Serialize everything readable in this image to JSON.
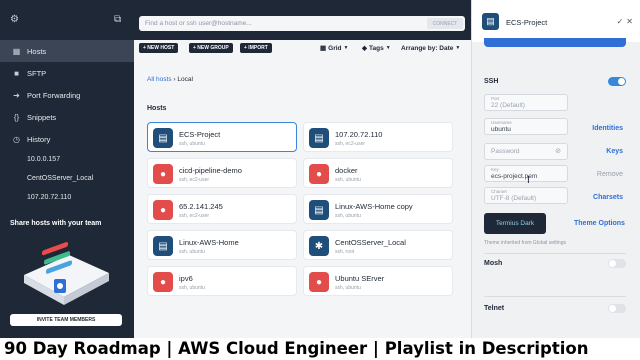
{
  "sidebar": {
    "nav": [
      {
        "label": "Hosts",
        "icon": "hosts-grid-icon",
        "active": true
      },
      {
        "label": "SFTP",
        "icon": "folder-icon",
        "active": false
      },
      {
        "label": "Port Forwarding",
        "icon": "arrow-right-icon",
        "active": false
      },
      {
        "label": "Snippets",
        "icon": "code-braces-icon",
        "active": false
      },
      {
        "label": "History",
        "icon": "clock-icon",
        "active": false
      }
    ],
    "history": [
      "10.0.0.157",
      "CentOSServer_Local",
      "107.20.72.110"
    ],
    "promo_title": "Share hosts with your team",
    "invite_label": "INVITE TEAM MEMBERS"
  },
  "main": {
    "search_placeholder": "Find a host or ssh user@hostname...",
    "connect_label": "CONNECT",
    "toolbar": {
      "new_host": "+ NEW HOST",
      "new_group": "+ NEW GROUP",
      "import": "+ IMPORT",
      "grid": "Grid",
      "tags": "Tags",
      "arrange": "Arrange by: Date"
    },
    "breadcrumb": {
      "root": "All hosts",
      "current": "Local"
    },
    "section_title": "Hosts",
    "hosts": [
      {
        "name": "ECS-Project",
        "sub": "ssh, ubuntu",
        "os": "server",
        "selected": true
      },
      {
        "name": "107.20.72.110",
        "sub": "ssh, ec2-user",
        "os": "server",
        "selected": false
      },
      {
        "name": "cicd-pipeline-demo",
        "sub": "ssh, ec2-user",
        "os": "linux",
        "selected": false
      },
      {
        "name": "docker",
        "sub": "ssh, ubuntu",
        "os": "linux",
        "selected": false
      },
      {
        "name": "65.2.141.245",
        "sub": "ssh, ec2-user",
        "os": "linux",
        "selected": false
      },
      {
        "name": "Linux-AWS-Home copy",
        "sub": "ssh, ubuntu",
        "os": "server",
        "selected": false
      },
      {
        "name": "Linux-AWS-Home",
        "sub": "ssh, ubuntu",
        "os": "server",
        "selected": false
      },
      {
        "name": "CentOSServer_Local",
        "sub": "ssh, root",
        "os": "centos",
        "selected": false
      },
      {
        "name": "ipv6",
        "sub": "ssh, ubuntu",
        "os": "linux",
        "selected": false
      },
      {
        "name": "Ubuntu SErver",
        "sub": "ssh, ubuntu",
        "os": "linux",
        "selected": false
      }
    ]
  },
  "panel": {
    "title": "ECS-Project",
    "ssh_label": "SSH",
    "ssh_enabled": true,
    "port": {
      "label": "Port",
      "placeholder": "22 (Default)"
    },
    "username": {
      "label": "Username",
      "value": "ubuntu"
    },
    "identities_link": "Identities",
    "password_placeholder": "Password",
    "keys_link": "Keys",
    "key": {
      "label": "Key",
      "value": "ecs-project.pem"
    },
    "remove_label": "Remove",
    "charset": {
      "label": "Charset",
      "placeholder": "UTF-8 (Default)"
    },
    "charsets_link": "Charsets",
    "theme_button": "Termius Dark",
    "theme_options": "Theme Options",
    "theme_note": "Theme inherited from Global settings",
    "mosh_label": "Mosh",
    "mosh_enabled": false,
    "telnet_label": "Telnet",
    "telnet_enabled": false
  },
  "caption": "90 Day Roadmap | AWS Cloud Engineer | Playlist in Description",
  "colors": {
    "sidebar_bg": "#1f2836",
    "accent": "#2f6fd6",
    "server_icon": "#1f4e7a",
    "linux_icon": "#e24c4b"
  }
}
